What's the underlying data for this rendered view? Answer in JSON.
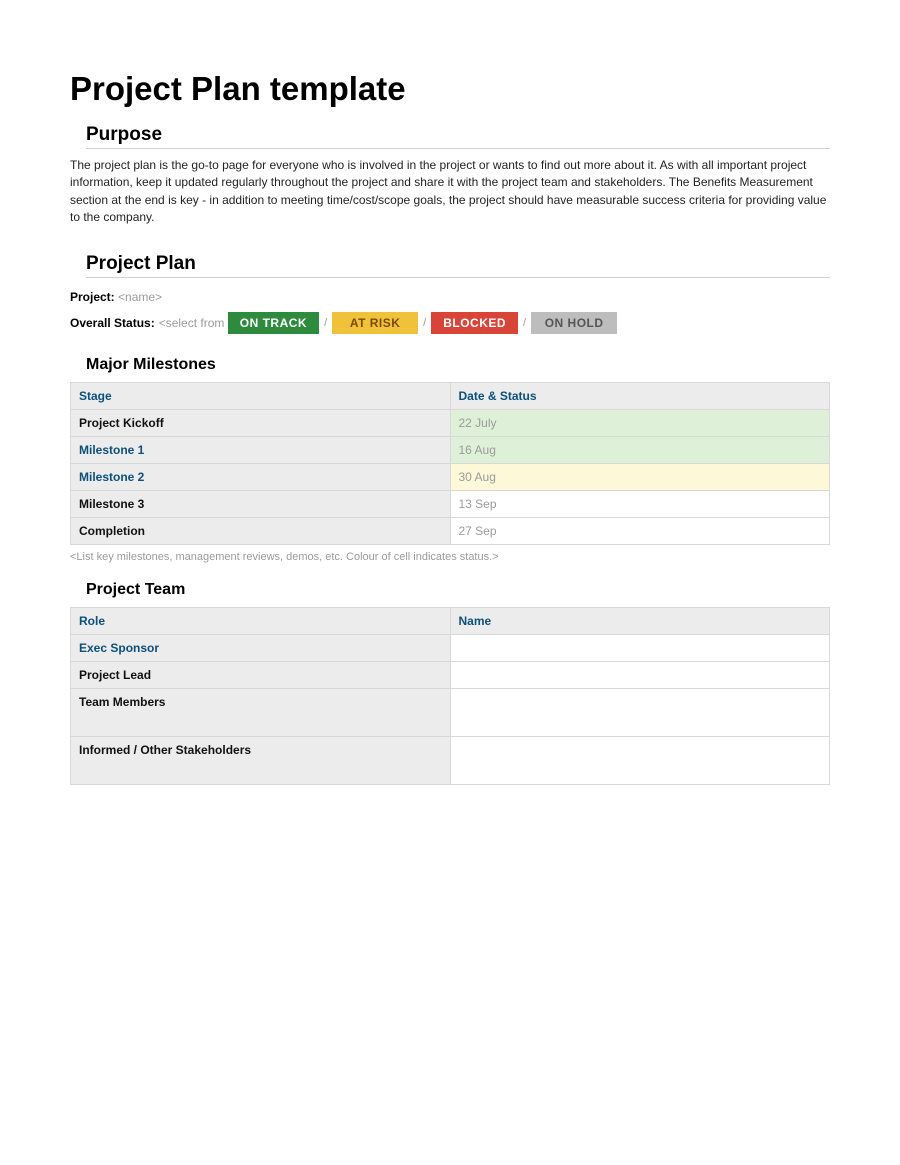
{
  "title": "Project Plan template",
  "purpose": {
    "heading": "Purpose",
    "body": "The project plan is the go-to page for everyone who is involved in the project or wants to find out more about it.   As with all important project information, keep it updated regularly throughout the project and share it with the project team and stakeholders.  The Benefits Measurement section at the end is key - in addition to meeting time/cost/scope goals, the project should have measurable success criteria for providing value to the company."
  },
  "plan": {
    "heading": "Project Plan",
    "project_label": "Project:",
    "project_value": "<name>",
    "status_label": "Overall Status:",
    "status_prefix": "<select from",
    "sep": "/",
    "options": {
      "on_track": "ON TRACK",
      "at_risk": "AT RISK",
      "blocked": "BLOCKED",
      "on_hold": "ON HOLD"
    }
  },
  "milestones": {
    "heading": "Major Milestones",
    "col_stage": "Stage",
    "col_date": "Date & Status",
    "rows": [
      {
        "stage": "Project Kickoff",
        "date": "22 July",
        "link": false,
        "status": "green"
      },
      {
        "stage": "Milestone 1",
        "date": "16 Aug",
        "link": true,
        "status": "green"
      },
      {
        "stage": "Milestone 2",
        "date": "30 Aug",
        "link": true,
        "status": "yellow"
      },
      {
        "stage": "Milestone 3",
        "date": "13 Sep",
        "link": false,
        "status": "none"
      },
      {
        "stage": "Completion",
        "date": "27 Sep",
        "link": false,
        "status": "none"
      }
    ],
    "hint": "<List key milestones, management reviews, demos, etc.  Colour of cell indicates status.>"
  },
  "team": {
    "heading": "Project Team",
    "col_role": "Role",
    "col_name": "Name",
    "rows": [
      {
        "role": "Exec Sponsor",
        "name": "",
        "link": true,
        "tall": false
      },
      {
        "role": "Project Lead",
        "name": "",
        "link": false,
        "tall": false
      },
      {
        "role": "Team Members",
        "name": "",
        "link": false,
        "tall": true
      },
      {
        "role": "Informed / Other Stakeholders",
        "name": "",
        "link": false,
        "tall": true
      }
    ]
  }
}
